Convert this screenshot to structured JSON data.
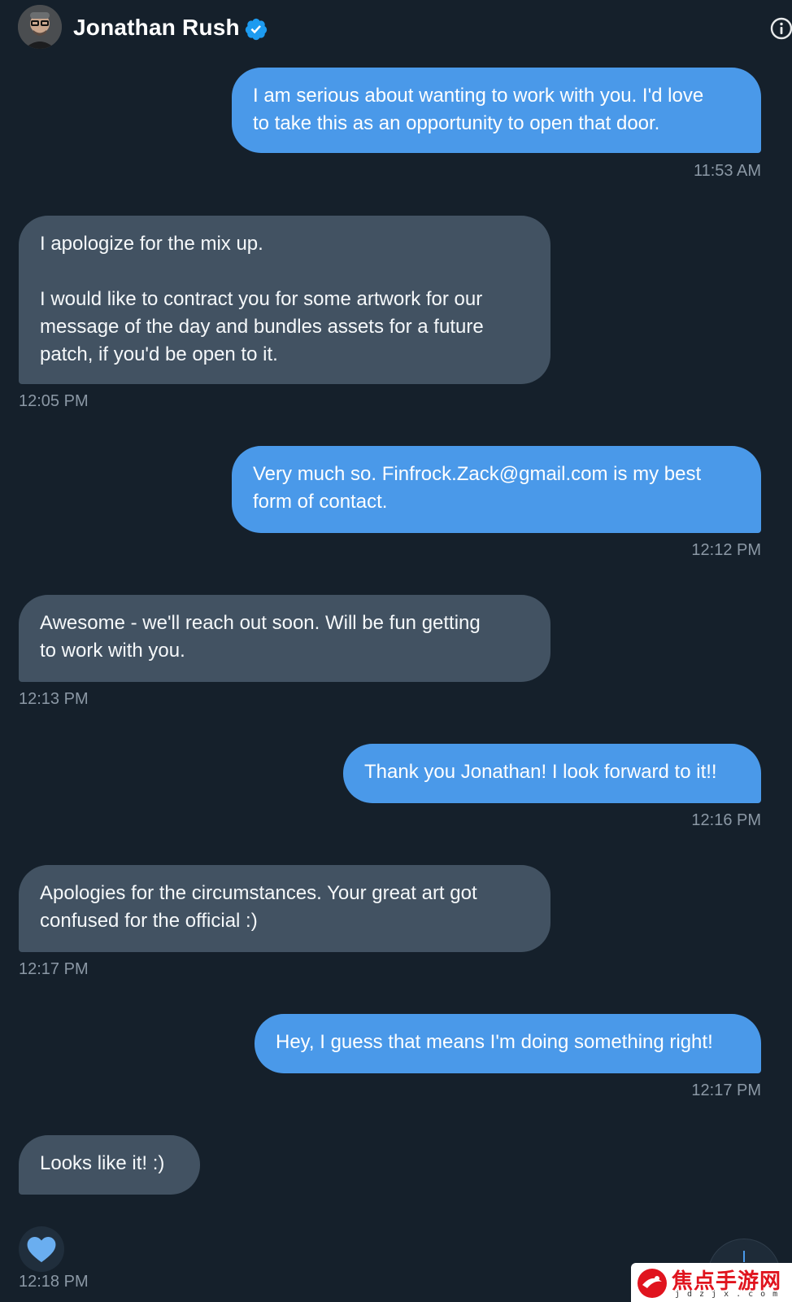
{
  "header": {
    "contact_name": "Jonathan Rush",
    "verified": true,
    "avatar_icon": "avatar-icon",
    "info_icon": "info-icon"
  },
  "colors": {
    "background": "#15202b",
    "outgoing_bubble": "#4a99e9",
    "incoming_bubble": "#425262",
    "timestamp": "#8b98a5",
    "accent": "#1d9bf0"
  },
  "messages": [
    {
      "direction": "out",
      "text": "I am serious about wanting to work with you. I'd love\nto take this as an opportunity to open that door.",
      "time": "11:53 AM"
    },
    {
      "direction": "in",
      "text": "I apologize for the mix up.\n\nI would like to contract you for some artwork for our\nmessage of the day and bundles assets for a future\npatch, if you'd be open to it.",
      "time": "12:05 PM"
    },
    {
      "direction": "out",
      "text": "Very much so. Finfrock.Zack@gmail.com is my best\nform of contact.",
      "time": "12:12 PM"
    },
    {
      "direction": "in",
      "text": "Awesome - we'll reach out soon.  Will be fun getting\nto work with you.",
      "time": "12:13 PM"
    },
    {
      "direction": "out",
      "text": "Thank you Jonathan! I look forward to it!!",
      "time": "12:16 PM"
    },
    {
      "direction": "in",
      "text": "Apologies for the circumstances.  Your great art got\nconfused for the official  :)",
      "time": "12:17 PM"
    },
    {
      "direction": "out",
      "text": "Hey, I guess that means I'm doing something right!",
      "time": "12:17 PM"
    },
    {
      "direction": "in",
      "text": "Looks like it!  :)",
      "time": "12:18 PM",
      "reaction": "heart-icon"
    }
  ],
  "watermark": {
    "title": "焦点手游网",
    "subtitle": "jdzjx.com"
  }
}
